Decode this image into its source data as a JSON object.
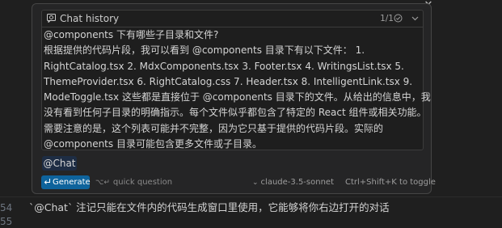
{
  "chat_panel": {
    "title": "Chat history",
    "count": "1/1",
    "message_lines": [
      "@components 下有哪些子目录和文件?",
      "根据提供的代码片段，我可以看到 @components 目录下有以下文件： 1.",
      "RightCatalog.tsx 2. MdxComponents.tsx 3. Footer.tsx 4. WritingsList.tsx 5.",
      "ThemeProvider.tsx 6. RightCatalog.css 7. Header.tsx 8. IntelligentLink.tsx 9.",
      "ModeToggle.tsx 这些都是直接位于 @components 目录下的文件。从给出的信息中，我",
      "没有看到任何子目录的明确指示。每个文件似乎都包含了特定的 React 组件或相关功能。",
      "需要注意的是，这个列表可能并不完整，因为它只基于提供的代码片段。实际的",
      "@components 目录可能包含更多文件或子目录。"
    ],
    "input_tag": "@Chat",
    "generate_label": "Generate",
    "quick_question_kbd": "⌥↵",
    "quick_question_label": "quick question",
    "model_name": "claude-3.5-sonnet",
    "toggle_hint": "Ctrl+Shift+K to toggle"
  },
  "editor": {
    "line_numbers": [
      "54",
      "55"
    ],
    "line_text": "`@Chat` 注记只能在文件内的代码生成窗口里使用，它能够将你右边打开的对话"
  },
  "colors": {
    "background": "#1f1f1f",
    "panel": "#252526",
    "accent": "#0e639c"
  }
}
